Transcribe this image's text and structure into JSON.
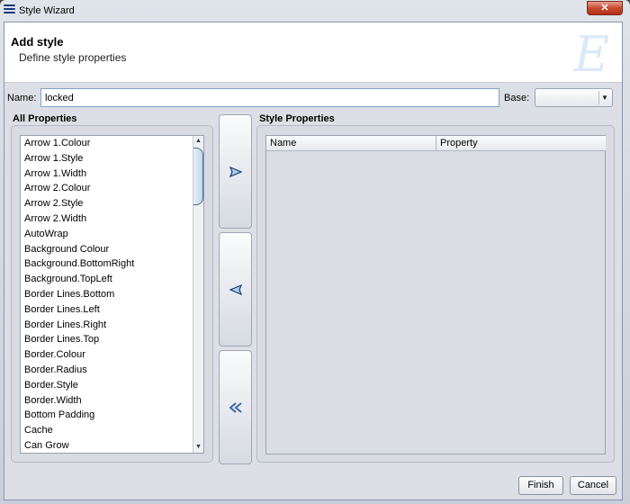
{
  "window": {
    "title": "Style Wizard",
    "close_glyph": "✕"
  },
  "header": {
    "title": "Add style",
    "subtitle": "Define style properties",
    "logo_glyph": "E"
  },
  "form": {
    "name_label": "Name:",
    "name_value": "locked",
    "base_label": "Base:",
    "base_value": ""
  },
  "all_properties": {
    "label": "All Properties",
    "items": [
      "Arrow 1.Colour",
      "Arrow 1.Style",
      "Arrow 1.Width",
      "Arrow 2.Colour",
      "Arrow 2.Style",
      "Arrow 2.Width",
      "AutoWrap",
      "Background Colour",
      "Background.BottomRight",
      "Background.TopLeft",
      "Border Lines.Bottom",
      "Border Lines.Left",
      "Border Lines.Right",
      "Border Lines.Top",
      "Border.Colour",
      "Border.Radius",
      "Border.Style",
      "Border.Width",
      "Bottom Padding",
      "Cache",
      "Can Grow"
    ]
  },
  "move_buttons": [
    {
      "icon": "arrow-right-icon"
    },
    {
      "icon": "arrow-left-icon"
    },
    {
      "icon": "double-arrow-left-icon"
    }
  ],
  "style_properties": {
    "label": "Style Properties",
    "columns": [
      "Name",
      "Property"
    ],
    "rows": []
  },
  "footer": {
    "finish_label": "Finish",
    "cancel_label": "Cancel"
  }
}
